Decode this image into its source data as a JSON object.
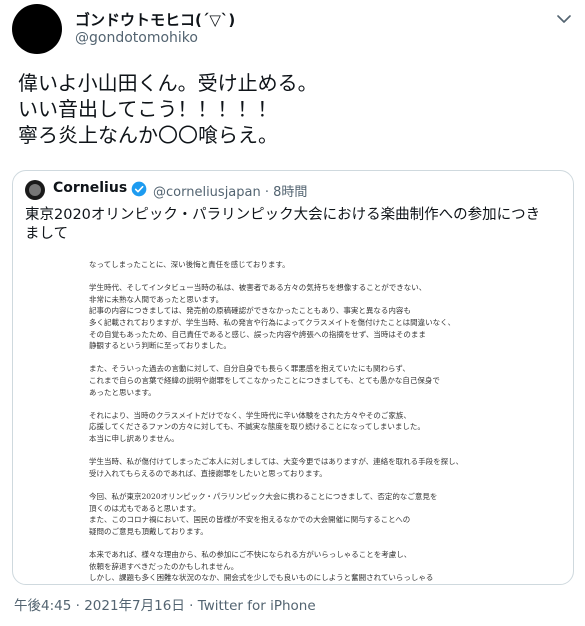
{
  "tweet": {
    "display_name": "ゴンドウトモヒコ(´▽`)",
    "username": "@gondotomohiko",
    "text_lines": [
      "偉いよ小山田くん。受け止める。",
      "いい音出してこう！！！！！",
      "寧ろ炎上なんか〇〇喰らえ。"
    ],
    "timestamp": "午後4:45 · 2021年7月16日 · ",
    "source": "Twitter for iPhone"
  },
  "quote": {
    "name": "Cornelius",
    "handle_time": "@corneliusjapan · 8時間",
    "text_lines": [
      "東京2020オリンピック・パラリンピック大会における楽曲制作への参加につき",
      "まして"
    ],
    "document_lines": [
      "なってしまったことに、深い後悔と責任を感じております。",
      "",
      "学生時代、そしてインタビュー当時の私は、被害者である方々の気持ちを想像することができない、",
      "非常に未熟な人間であったと思います。",
      "記事の内容につきましては、発売前の原稿確認ができなかったこともあり、事実と異なる内容も",
      "多く記載されておりますが、学生当時、私の発言や行為によってクラスメイトを傷付けたことは間違いなく、",
      "その自覚もあったため、自己責任であると感じ、誤った内容や誇張への指摘をせず、当時はそのまま",
      "静観するという判断に至っておりました。",
      "",
      "また、そういった過去の言動に対して、自分自身でも長らく罪悪感を抱えていたにも関わらず、",
      "これまで自らの言葉で経緯の説明や謝罪をしてこなかったことにつきましても、とても愚かな自己保身で",
      "あったと思います。",
      "",
      "それにより、当時のクラスメイトだけでなく、学生時代に辛い体験をされた方々やそのご家族、",
      "応援してくださるファンの方々に対しても、不誠実な態度を取り続けることになってしまいました。",
      "本当に申し訳ありません。",
      "",
      "学生当時、私が傷付けてしまったご本人に対しましては、大変今更ではありますが、連絡を取れる手段を探し、",
      "受け入れてもらえるのであれば、直接謝罪をしたいと思っております。",
      "",
      "今回、私が東京2020オリンピック・パラリンピック大会に携わることにつきまして、否定的なご意見を",
      "頂くのは尤もであると思います。",
      "また、このコロナ禍において、国民の皆様が不安を抱えるなかでの大会開催に関与することへの",
      "疑問のご意見も頂戴しております。",
      "",
      "本来であれば、様々な理由から、私の参加にご不快になられる方がいらっしゃることを考慮し、",
      "依頼を辞退すべきだったのかもしれません。",
      "しかし、課題も多く困難な状況のなか、開会式を少しでも良いものにしようと奮闘されていらっしゃる"
    ]
  },
  "colors": {
    "text": "#0f1419",
    "secondary": "#536471",
    "border": "#cfd9de",
    "verified": "#1d9bf0"
  },
  "icons": [
    "chevron-down-icon",
    "verified-badge-icon"
  ]
}
